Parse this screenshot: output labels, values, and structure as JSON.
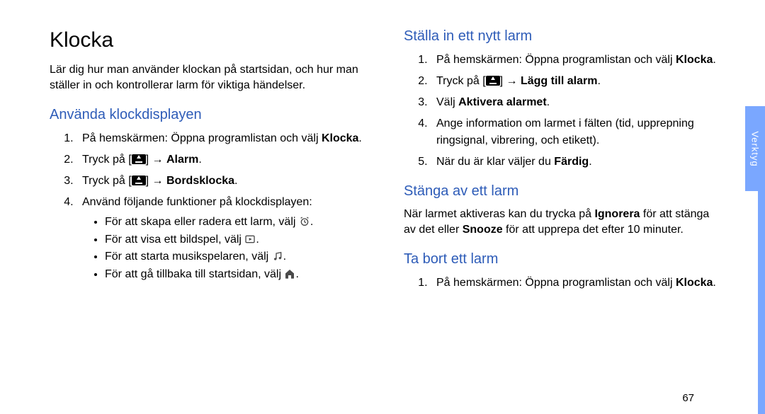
{
  "pageNumber": "67",
  "sideTab": "Verktyg",
  "left": {
    "title": "Klocka",
    "intro": "Lär dig hur man använder klockan på startsidan, och hur man ställer in och kontrollerar larm för viktiga händelser.",
    "section1": {
      "heading": "Använda klockdisplayen",
      "step1a": "På hemskärmen: Öppna programlistan och välj ",
      "step1b": "Klocka",
      "step1c": ".",
      "step2a": "Tryck på [",
      "step2b": "] → ",
      "step2c": "Alarm",
      "step2d": ".",
      "step3a": "Tryck på [",
      "step3b": "] → ",
      "step3c": "Bordsklocka",
      "step3d": ".",
      "step4": "Använd följande funktioner på klockdisplayen:",
      "b1": "För att skapa eller radera ett larm, välj ",
      "b2": "För att visa ett bildspel, välj ",
      "b3": "För att starta musikspelaren, välj ",
      "b4": "För att gå tillbaka till startsidan, välj ",
      "bEnd": "."
    }
  },
  "right": {
    "section2": {
      "heading": "Ställa in ett nytt larm",
      "step1a": "På hemskärmen: Öppna programlistan och välj ",
      "step1b": "Klocka",
      "step1c": ".",
      "step2a": "Tryck på [",
      "step2b": "] → ",
      "step2c": "Lägg till alarm",
      "step2d": ".",
      "step3a": "Välj ",
      "step3b": "Aktivera alarmet",
      "step3c": ".",
      "step4": "Ange information om larmet i fälten (tid, upprepning ringsignal, vibrering, och etikett).",
      "step5a": "När du är klar väljer du ",
      "step5b": "Färdig",
      "step5c": "."
    },
    "section3": {
      "heading": "Stänga av ett larm",
      "p1a": "När larmet aktiveras kan du trycka på ",
      "p1b": "Ignorera",
      "p1c": " för att stänga av det eller ",
      "p1d": "Snooze",
      "p1e": " för att upprepa det efter 10 minuter."
    },
    "section4": {
      "heading": "Ta bort ett larm",
      "step1a": "På hemskärmen: Öppna programlistan och välj ",
      "step1b": "Klocka",
      "step1c": "."
    }
  }
}
